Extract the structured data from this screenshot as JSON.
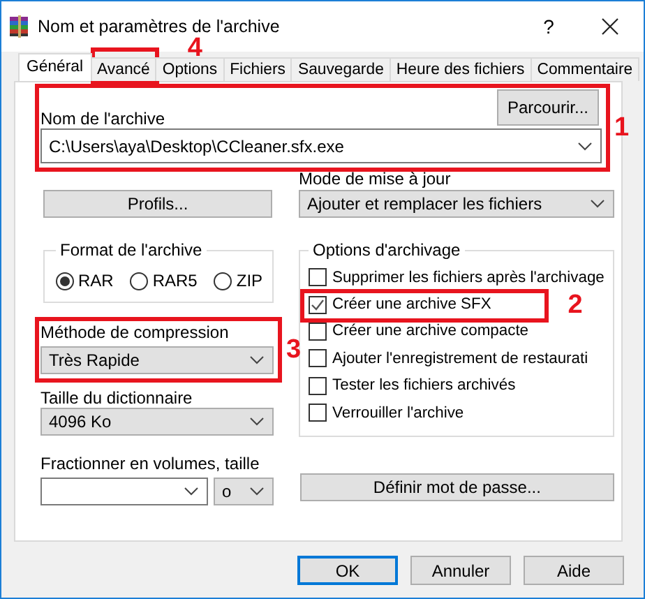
{
  "window": {
    "title": "Nom et paramètres de l'archive",
    "help_button": "?"
  },
  "tabs": [
    {
      "label": "Général",
      "selected": true
    },
    {
      "label": "Avancé",
      "selected": false,
      "annotation": "4"
    },
    {
      "label": "Options",
      "selected": false
    },
    {
      "label": "Fichiers",
      "selected": false
    },
    {
      "label": "Sauvegarde",
      "selected": false
    },
    {
      "label": "Heure des fichiers",
      "selected": false
    },
    {
      "label": "Commentaire",
      "selected": false
    }
  ],
  "archive_name": {
    "annotation": "1",
    "label": "Nom de l'archive",
    "browse_button": "Parcourir...",
    "value": "C:\\Users\\aya\\Desktop\\CCleaner.sfx.exe"
  },
  "profiles_button": "Profils...",
  "update_mode": {
    "label": "Mode de mise à jour",
    "value": "Ajouter et remplacer les fichiers"
  },
  "archive_format": {
    "label": "Format de l'archive",
    "options": [
      {
        "label": "RAR",
        "selected": true
      },
      {
        "label": "RAR5",
        "selected": false
      },
      {
        "label": "ZIP",
        "selected": false
      }
    ]
  },
  "compression_method": {
    "annotation": "3",
    "label": "Méthode de compression",
    "value": "Très Rapide"
  },
  "dictionary_size": {
    "label": "Taille du dictionnaire",
    "value": "4096 Ko"
  },
  "split_volumes": {
    "label": "Fractionner en volumes, taille",
    "unit": "o"
  },
  "archiving_options": {
    "label": "Options d'archivage",
    "items": [
      {
        "label": "Supprimer les fichiers après l'archivage",
        "checked": false
      },
      {
        "label": "Créer une archive SFX",
        "checked": true,
        "annotation": "2"
      },
      {
        "label": "Créer une archive compacte",
        "checked": false
      },
      {
        "label": "Ajouter l'enregistrement de restaurati",
        "checked": false
      },
      {
        "label": "Tester les fichiers archivés",
        "checked": false
      },
      {
        "label": "Verrouiller l'archive",
        "checked": false
      }
    ]
  },
  "password_button": "Définir mot de passe...",
  "buttons": [
    {
      "label": "OK",
      "default": true
    },
    {
      "label": "Annuler",
      "default": false
    },
    {
      "label": "Aide",
      "default": false
    }
  ]
}
